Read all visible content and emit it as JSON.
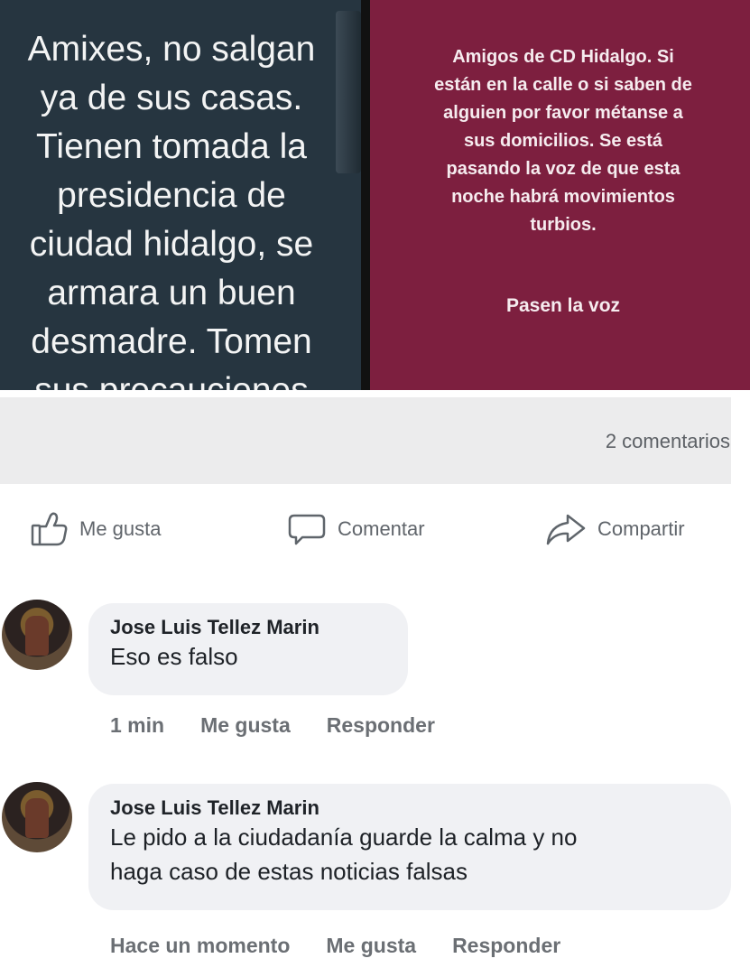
{
  "post": {
    "images": {
      "left_text": "Amixes, no salgan\nya de sus casas.\nTienen tomada la\npresidencia de\nciudad hidalgo, se\narmara un buen\ndesmadre. Tomen\nsus precauciones",
      "right_text": "Amigos de CD Hidalgo. Si\nestán en la calle o si saben de\nalguien por favor métanse a\nsus domicilios. Se está\npasando la voz de que esta\nnoche habrá movimientos\nturbios.",
      "right_cta": "Pasen la voz"
    },
    "comments_count": "2 comentarios",
    "actions": {
      "like": "Me gusta",
      "comment": "Comentar",
      "share": "Compartir"
    }
  },
  "comments": [
    {
      "author": "Jose Luis Tellez Marin",
      "text": "Eso es falso",
      "time": "1 min",
      "like": "Me gusta",
      "reply": "Responder"
    },
    {
      "author": "Jose Luis Tellez Marin",
      "text": "Le pido a la ciudadanía guarde la calma y no\nhaga caso de estas noticias falsas",
      "time": "Hace un momento",
      "like": "Me gusta",
      "reply": "Responder"
    }
  ],
  "colors": {
    "left_image_bg": "#263540",
    "right_image_bg": "#7d1f3f",
    "bubble_bg": "#f0f1f4"
  }
}
